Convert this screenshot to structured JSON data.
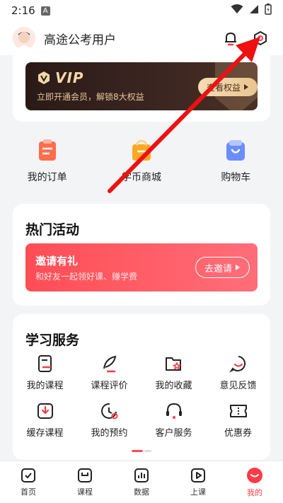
{
  "status_bar": {
    "time": "2:16",
    "notif_letter": "A"
  },
  "header": {
    "username": "高途公考用户"
  },
  "vip": {
    "badge_text": "VIP",
    "subtitle": "立即开通会员，解锁8大权益",
    "button_label": "查看权益"
  },
  "quick_actions": [
    {
      "label": "我的订单",
      "icon": "order-icon"
    },
    {
      "label": "学币商城",
      "icon": "coin-shop-icon"
    },
    {
      "label": "购物车",
      "icon": "cart-icon"
    }
  ],
  "hot": {
    "title": "热门活动",
    "invite_title": "邀请有礼",
    "invite_subtitle": "和好友一起领好课、赚学费",
    "invite_button": "去邀请"
  },
  "services": {
    "title": "学习服务",
    "items": [
      {
        "label": "我的课程",
        "icon": "course-icon"
      },
      {
        "label": "课程评价",
        "icon": "feather-icon"
      },
      {
        "label": "我的收藏",
        "icon": "favorite-folder-icon"
      },
      {
        "label": "意见反馈",
        "icon": "feedback-icon"
      },
      {
        "label": "缓存课程",
        "icon": "download-icon"
      },
      {
        "label": "我的预约",
        "icon": "clock-icon"
      },
      {
        "label": "客户服务",
        "icon": "headset-icon"
      },
      {
        "label": "优惠券",
        "icon": "coupon-icon"
      }
    ]
  },
  "tabbar": [
    {
      "label": "首页",
      "icon": "home-check-icon",
      "active": false
    },
    {
      "label": "课程",
      "icon": "course-book-icon",
      "active": false
    },
    {
      "label": "数据",
      "icon": "chart-icon",
      "active": false
    },
    {
      "label": "上课",
      "icon": "play-icon",
      "active": false
    },
    {
      "label": "我的",
      "icon": "profile-face-icon",
      "active": true
    }
  ],
  "colors": {
    "accent": "#ff3b47",
    "vip_dark": "#2a1a17",
    "vip_gold": "#f3d7a7"
  }
}
